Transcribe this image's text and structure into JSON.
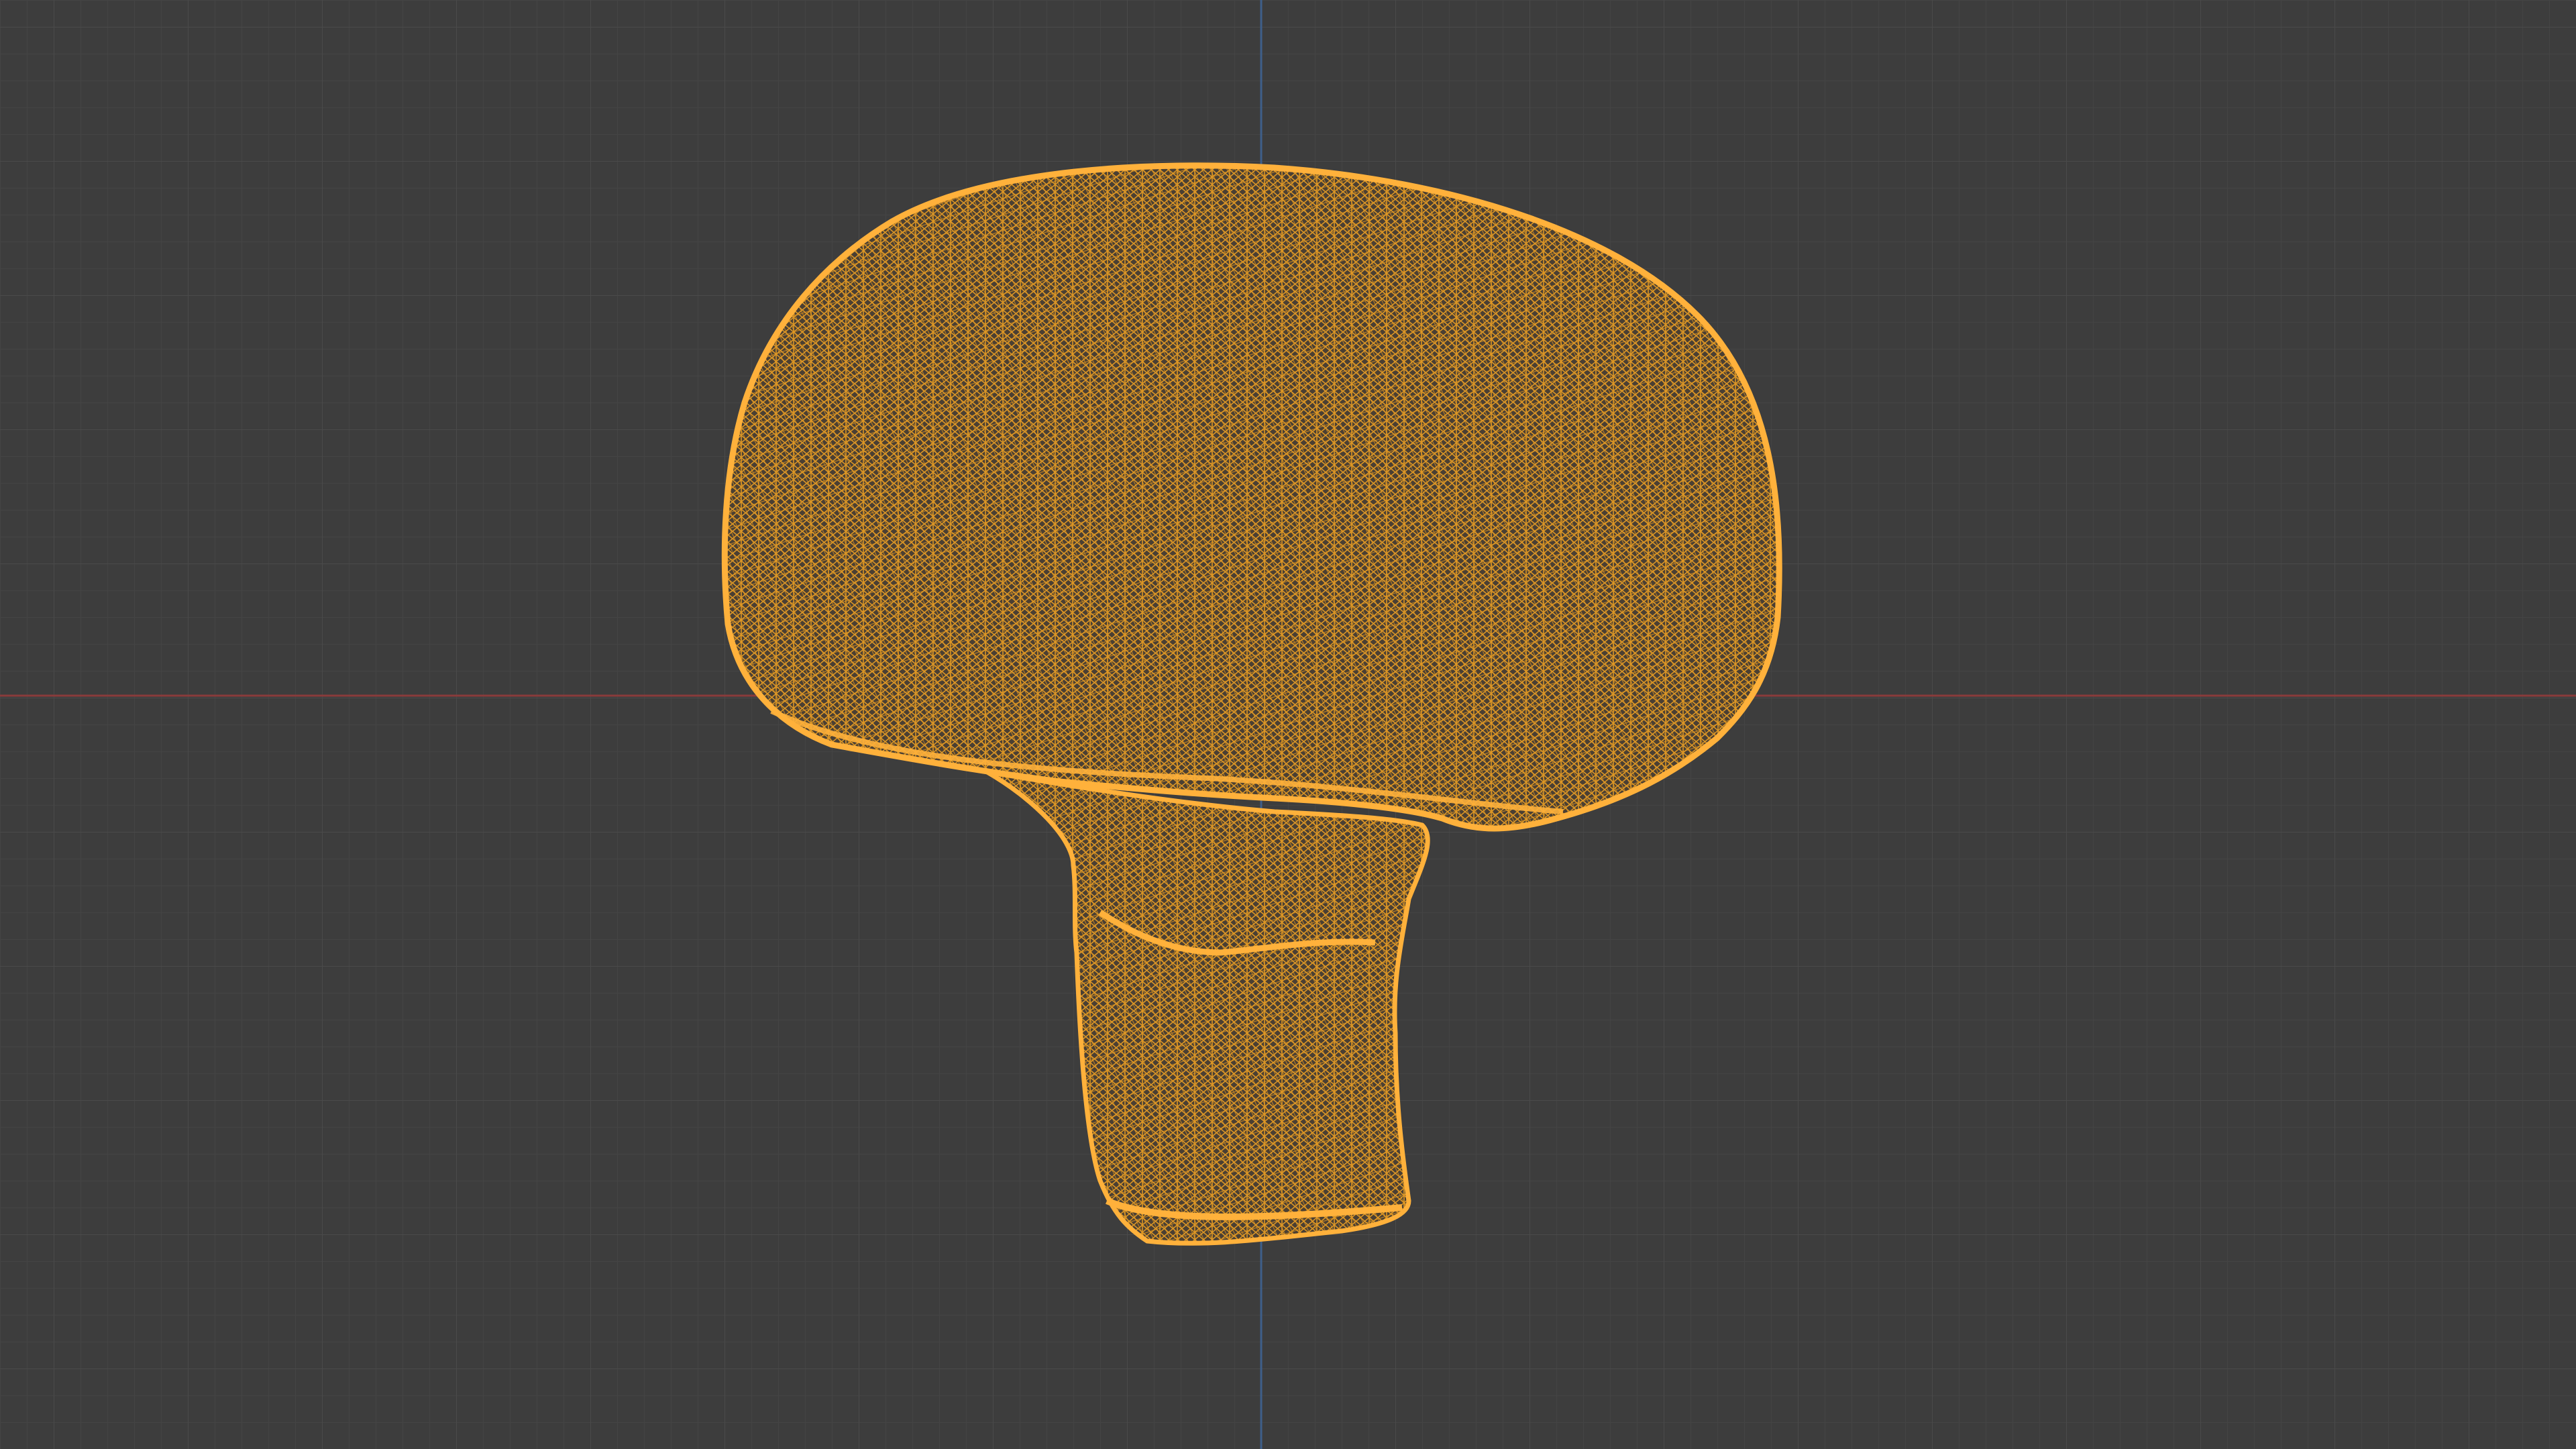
{
  "viewport": {
    "mode": "wireframe",
    "colors": {
      "background": "#3d3d3d",
      "grid_minor": "#444444",
      "grid_major": "#4a4a4a",
      "axis_x": "#8a3b3b",
      "axis_z": "#3e5f8a",
      "wireframe": "#f5a623",
      "wireframe_dense": "#ffb13b",
      "mesh_fill": "#4a3f33"
    },
    "object": {
      "type": "mesh",
      "icon": "mushroom-mesh"
    }
  }
}
